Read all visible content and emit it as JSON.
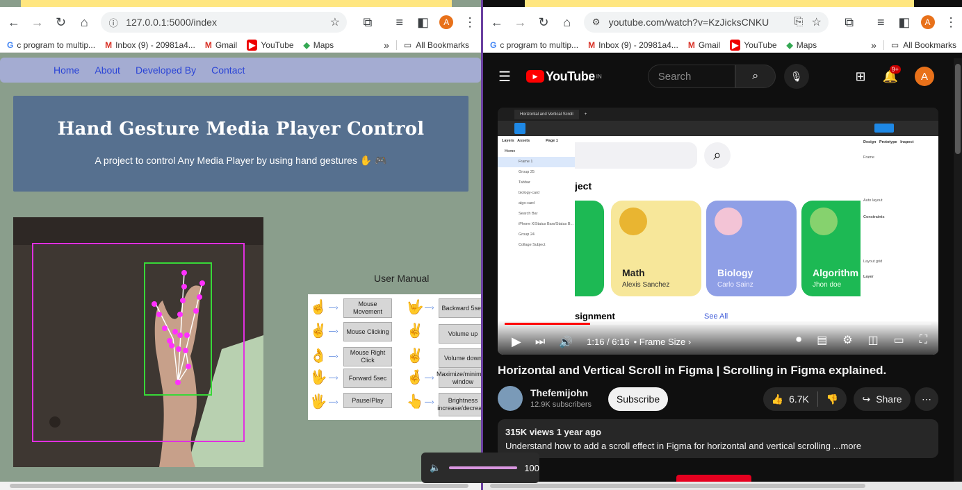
{
  "left_window": {
    "url": "127.0.0.1:5000/index",
    "bookmarks": [
      {
        "icon": "G",
        "label": "c program to multip..."
      },
      {
        "icon": "M",
        "label": "Inbox (9) - 20981a4..."
      },
      {
        "icon": "M",
        "label": "Gmail"
      },
      {
        "icon": "▶",
        "label": "YouTube"
      },
      {
        "icon": "◆",
        "label": "Maps"
      }
    ],
    "all_bookmarks": "All Bookmarks",
    "profile_initial": "A",
    "page": {
      "nav": [
        "Home",
        "About",
        "Developed By",
        "Contact"
      ],
      "title": "Hand Gesture Media Player Control",
      "subtitle": "A project to control Any Media Player by using hand gestures ✋ 🎮",
      "user_manual_label": "User Manual",
      "manual_items": [
        {
          "gesture": "☝",
          "label": "Mouse Movement"
        },
        {
          "gesture": "✌",
          "label": "Mouse Clicking"
        },
        {
          "gesture": "👌",
          "label": "Mouse Right Click"
        },
        {
          "gesture": "🖖",
          "label": "Forward 5sec"
        },
        {
          "gesture": "🖐",
          "label": "Pause/Play"
        },
        {
          "gesture": "🤟",
          "label": "Backward 5sec"
        },
        {
          "gesture": "✌",
          "label": "Volume up"
        },
        {
          "gesture": "✌",
          "label": "Volume down"
        },
        {
          "gesture": "🤞",
          "label": "Maximize/minimize window"
        },
        {
          "gesture": "👆",
          "label": "Brightness increase/decrease"
        }
      ]
    }
  },
  "volume_overlay": {
    "icon": "speaker-icon",
    "value": "100"
  },
  "right_window": {
    "url": "youtube.com/watch?v=KzJicksCNKU",
    "bookmarks": [
      {
        "icon": "G",
        "label": "c program to multip..."
      },
      {
        "icon": "M",
        "label": "Inbox (9) - 20981a4..."
      },
      {
        "icon": "M",
        "label": "Gmail"
      },
      {
        "icon": "▶",
        "label": "YouTube"
      },
      {
        "icon": "◆",
        "label": "Maps"
      }
    ],
    "all_bookmarks": "All Bookmarks",
    "profile_initial": "A",
    "youtube": {
      "logo": "YouTube",
      "region": "IN",
      "search_placeholder": "Search",
      "notif_badge": "9+",
      "avatar": "A",
      "player": {
        "figma_tab": "Horizontal and Vertical Scroll",
        "layers_header": [
          "Layers",
          "Assets",
          "Page 1"
        ],
        "layers": [
          "Home",
          "Frame 1",
          "Group 25",
          "Tabbar",
          "biology-card",
          "algo-card",
          "Search Bar",
          "iPhone X/Status Bars/Status B...",
          "Group 24",
          "Collage Subject"
        ],
        "canvas_heading": "ject",
        "canvas_bottom": "signment",
        "see_all": "See All",
        "cards": [
          {
            "title": "Math",
            "sub": "Alexis Sanchez",
            "color": "#f7e79a"
          },
          {
            "title": "Biology",
            "sub": "Carlo Sainz",
            "color": "#8f9fe6"
          },
          {
            "title": "Algorithm",
            "sub": "Jhon doe",
            "color": "#1db954"
          }
        ],
        "time": "1:16 / 6:16",
        "chapter": "• Frame Size ›",
        "progress_fraction": 0.2,
        "design_labels": [
          "Design",
          "Prototype",
          "Inspect",
          "Frame",
          "Auto layout",
          "Constraints",
          "Layout grid",
          "Layer"
        ]
      },
      "video_title": "Horizontal and Vertical Scroll in Figma | Scrolling in Figma explained.",
      "channel": "Thefemijohn",
      "subscribers": "12.9K subscribers",
      "subscribe": "Subscribe",
      "likes": "6.7K",
      "share": "Share",
      "views": "315K views  1 year ago",
      "description": "Understand how to add a scroll effect in Figma for horizontal and vertical scrolling ...more"
    }
  }
}
